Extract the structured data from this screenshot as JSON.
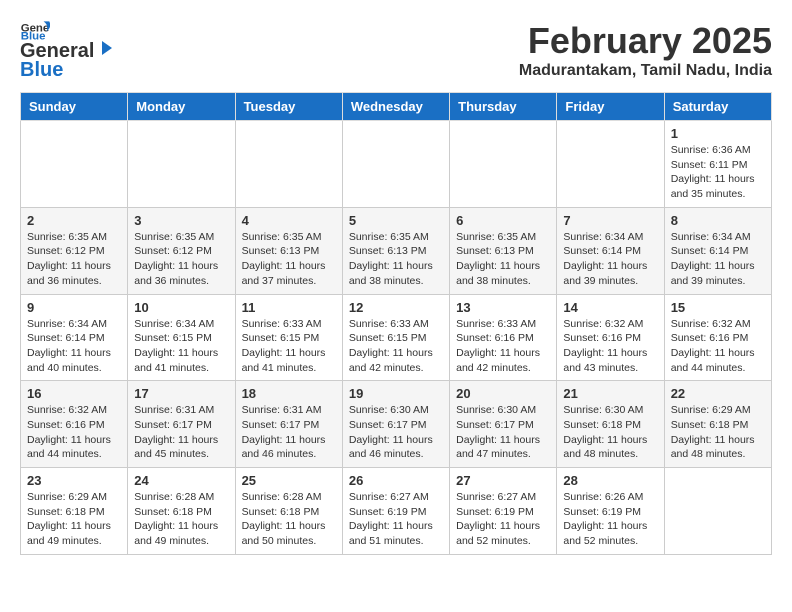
{
  "logo": {
    "general": "General",
    "blue": "Blue"
  },
  "title": "February 2025",
  "location": "Madurantakam, Tamil Nadu, India",
  "days_header": [
    "Sunday",
    "Monday",
    "Tuesday",
    "Wednesday",
    "Thursday",
    "Friday",
    "Saturday"
  ],
  "weeks": [
    [
      {
        "day": "",
        "info": ""
      },
      {
        "day": "",
        "info": ""
      },
      {
        "day": "",
        "info": ""
      },
      {
        "day": "",
        "info": ""
      },
      {
        "day": "",
        "info": ""
      },
      {
        "day": "",
        "info": ""
      },
      {
        "day": "1",
        "info": "Sunrise: 6:36 AM\nSunset: 6:11 PM\nDaylight: 11 hours\nand 35 minutes."
      }
    ],
    [
      {
        "day": "2",
        "info": "Sunrise: 6:35 AM\nSunset: 6:12 PM\nDaylight: 11 hours\nand 36 minutes."
      },
      {
        "day": "3",
        "info": "Sunrise: 6:35 AM\nSunset: 6:12 PM\nDaylight: 11 hours\nand 36 minutes."
      },
      {
        "day": "4",
        "info": "Sunrise: 6:35 AM\nSunset: 6:13 PM\nDaylight: 11 hours\nand 37 minutes."
      },
      {
        "day": "5",
        "info": "Sunrise: 6:35 AM\nSunset: 6:13 PM\nDaylight: 11 hours\nand 38 minutes."
      },
      {
        "day": "6",
        "info": "Sunrise: 6:35 AM\nSunset: 6:13 PM\nDaylight: 11 hours\nand 38 minutes."
      },
      {
        "day": "7",
        "info": "Sunrise: 6:34 AM\nSunset: 6:14 PM\nDaylight: 11 hours\nand 39 minutes."
      },
      {
        "day": "8",
        "info": "Sunrise: 6:34 AM\nSunset: 6:14 PM\nDaylight: 11 hours\nand 39 minutes."
      }
    ],
    [
      {
        "day": "9",
        "info": "Sunrise: 6:34 AM\nSunset: 6:14 PM\nDaylight: 11 hours\nand 40 minutes."
      },
      {
        "day": "10",
        "info": "Sunrise: 6:34 AM\nSunset: 6:15 PM\nDaylight: 11 hours\nand 41 minutes."
      },
      {
        "day": "11",
        "info": "Sunrise: 6:33 AM\nSunset: 6:15 PM\nDaylight: 11 hours\nand 41 minutes."
      },
      {
        "day": "12",
        "info": "Sunrise: 6:33 AM\nSunset: 6:15 PM\nDaylight: 11 hours\nand 42 minutes."
      },
      {
        "day": "13",
        "info": "Sunrise: 6:33 AM\nSunset: 6:16 PM\nDaylight: 11 hours\nand 42 minutes."
      },
      {
        "day": "14",
        "info": "Sunrise: 6:32 AM\nSunset: 6:16 PM\nDaylight: 11 hours\nand 43 minutes."
      },
      {
        "day": "15",
        "info": "Sunrise: 6:32 AM\nSunset: 6:16 PM\nDaylight: 11 hours\nand 44 minutes."
      }
    ],
    [
      {
        "day": "16",
        "info": "Sunrise: 6:32 AM\nSunset: 6:16 PM\nDaylight: 11 hours\nand 44 minutes."
      },
      {
        "day": "17",
        "info": "Sunrise: 6:31 AM\nSunset: 6:17 PM\nDaylight: 11 hours\nand 45 minutes."
      },
      {
        "day": "18",
        "info": "Sunrise: 6:31 AM\nSunset: 6:17 PM\nDaylight: 11 hours\nand 46 minutes."
      },
      {
        "day": "19",
        "info": "Sunrise: 6:30 AM\nSunset: 6:17 PM\nDaylight: 11 hours\nand 46 minutes."
      },
      {
        "day": "20",
        "info": "Sunrise: 6:30 AM\nSunset: 6:17 PM\nDaylight: 11 hours\nand 47 minutes."
      },
      {
        "day": "21",
        "info": "Sunrise: 6:30 AM\nSunset: 6:18 PM\nDaylight: 11 hours\nand 48 minutes."
      },
      {
        "day": "22",
        "info": "Sunrise: 6:29 AM\nSunset: 6:18 PM\nDaylight: 11 hours\nand 48 minutes."
      }
    ],
    [
      {
        "day": "23",
        "info": "Sunrise: 6:29 AM\nSunset: 6:18 PM\nDaylight: 11 hours\nand 49 minutes."
      },
      {
        "day": "24",
        "info": "Sunrise: 6:28 AM\nSunset: 6:18 PM\nDaylight: 11 hours\nand 49 minutes."
      },
      {
        "day": "25",
        "info": "Sunrise: 6:28 AM\nSunset: 6:18 PM\nDaylight: 11 hours\nand 50 minutes."
      },
      {
        "day": "26",
        "info": "Sunrise: 6:27 AM\nSunset: 6:19 PM\nDaylight: 11 hours\nand 51 minutes."
      },
      {
        "day": "27",
        "info": "Sunrise: 6:27 AM\nSunset: 6:19 PM\nDaylight: 11 hours\nand 52 minutes."
      },
      {
        "day": "28",
        "info": "Sunrise: 6:26 AM\nSunset: 6:19 PM\nDaylight: 11 hours\nand 52 minutes."
      },
      {
        "day": "",
        "info": ""
      }
    ]
  ]
}
